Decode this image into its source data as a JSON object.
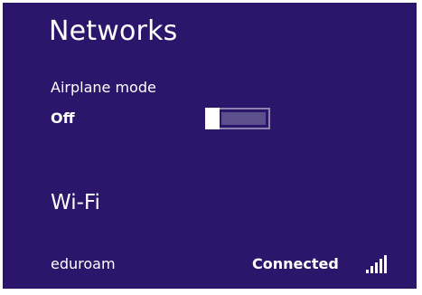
{
  "panel": {
    "title": "Networks"
  },
  "airplane_mode": {
    "label": "Airplane mode",
    "state": "Off",
    "on": false
  },
  "wifi": {
    "heading": "Wi-Fi",
    "networks": [
      {
        "name": "eduroam",
        "status": "Connected",
        "signal_icon": "signal-strength-icon",
        "signal_bars": 5
      }
    ]
  },
  "colors": {
    "background": "#2b166b",
    "text": "#ffffff",
    "toggle_track": "#5b4f8c",
    "toggle_border": "#8c82b0"
  }
}
